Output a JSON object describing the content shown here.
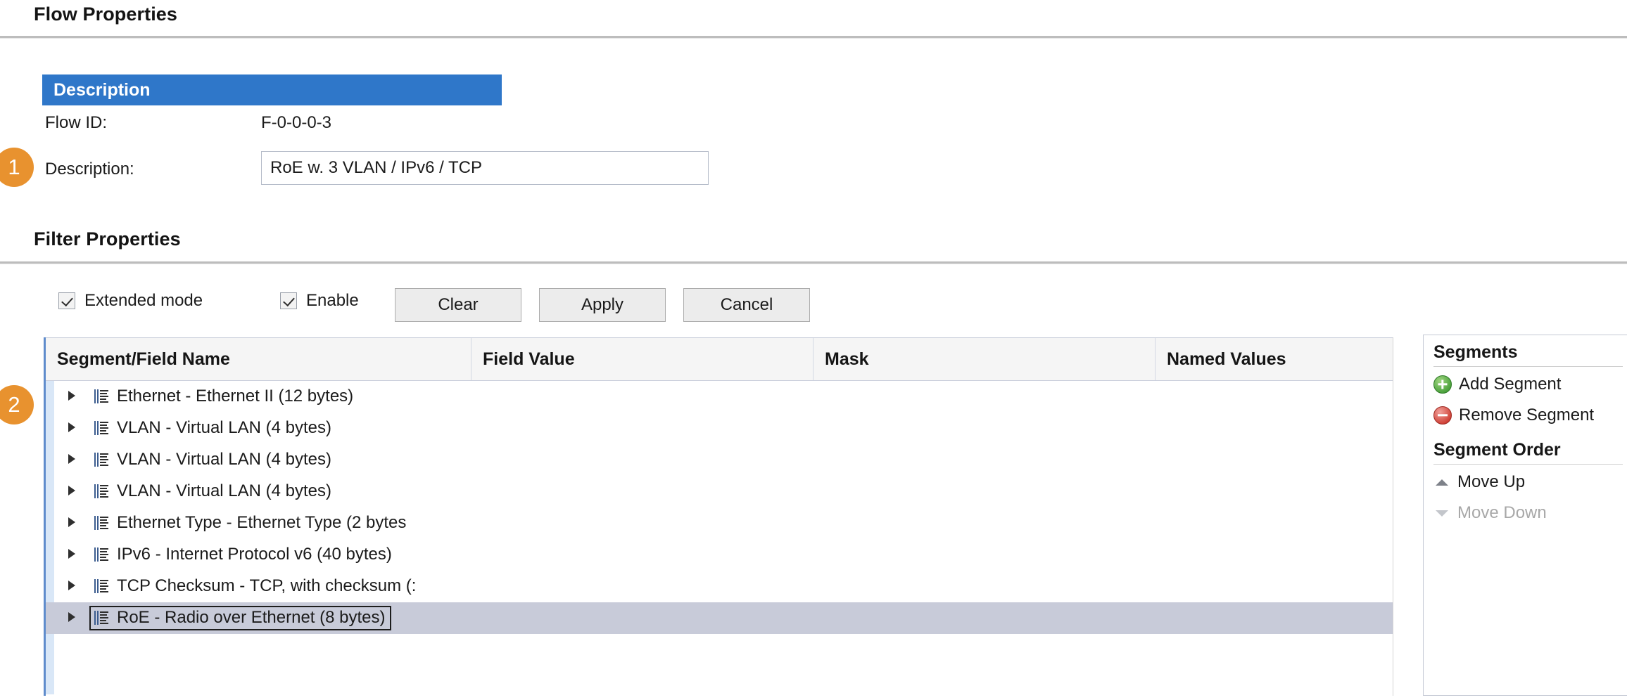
{
  "sections": {
    "flow_properties_title": "Flow Properties",
    "filter_properties_title": "Filter Properties"
  },
  "callouts": {
    "one": "1",
    "two": "2"
  },
  "description_group": {
    "header": "Description",
    "flow_id_label": "Flow ID:",
    "flow_id_value": "F-0-0-0-3",
    "description_label": "Description:",
    "description_value": "RoE w. 3 VLAN / IPv6 / TCP",
    "description_placeholder": "Description",
    "header_color": "#2f77c9"
  },
  "filter_toolbar": {
    "extended_mode_label": "Extended mode",
    "extended_mode_checked": true,
    "enable_label": "Enable",
    "enable_checked": true,
    "clear_label": "Clear",
    "apply_label": "Apply",
    "cancel_label": "Cancel"
  },
  "grid": {
    "columns": [
      "Segment/Field Name",
      "Field Value",
      "Mask",
      "Named Values"
    ],
    "rows": [
      {
        "label": "Ethernet - Ethernet II (12 bytes)",
        "selected": false
      },
      {
        "label": "VLAN - Virtual LAN (4 bytes)",
        "selected": false
      },
      {
        "label": "VLAN - Virtual LAN (4 bytes)",
        "selected": false
      },
      {
        "label": "VLAN - Virtual LAN (4 bytes)",
        "selected": false
      },
      {
        "label": "Ethernet Type - Ethernet Type (2 bytes",
        "selected": false
      },
      {
        "label": "IPv6 - Internet Protocol v6 (40 bytes)",
        "selected": false
      },
      {
        "label": "TCP Checksum - TCP, with checksum (:",
        "selected": false
      },
      {
        "label": "RoE - Radio over Ethernet (8 bytes)",
        "selected": true
      }
    ],
    "selected_row_color": "#c8cbd9",
    "gutter_color": "#d9e7f7",
    "accent_color": "#5f8ccc"
  },
  "side_panel": {
    "segments_title": "Segments",
    "add_segment": "Add Segment",
    "remove_segment": "Remove Segment",
    "segment_order_title": "Segment Order",
    "move_up": "Move Up",
    "move_down": "Move Down",
    "move_down_disabled": true
  }
}
